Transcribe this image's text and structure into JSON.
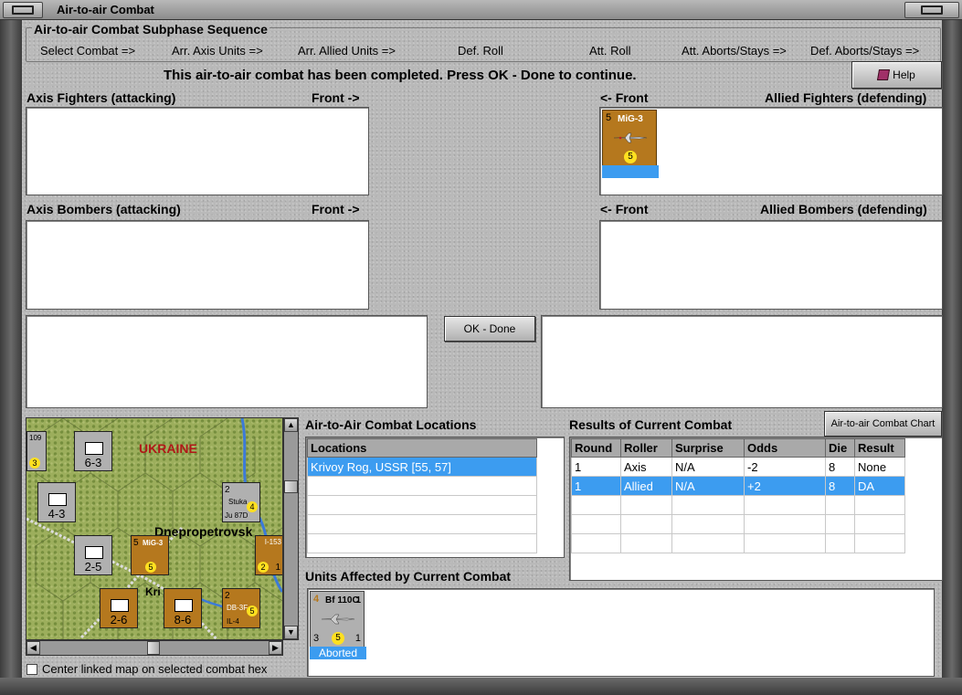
{
  "window": {
    "title": "Air-to-air Combat"
  },
  "subphase": {
    "label": "Air-to-air Combat Subphase Sequence",
    "steps": [
      "Select Combat =>",
      "Arr. Axis Units =>",
      "Arr. Allied Units =>",
      "Def. Roll",
      "Att. Roll",
      "Att. Aborts/Stays =>",
      "Def. Aborts/Stays =>"
    ]
  },
  "status_message": "This air-to-air combat has been completed.  Press OK - Done to continue.",
  "help_label": "Help",
  "sections": {
    "axis_fighters": "Axis Fighters (attacking)",
    "axis_fighters_front": "Front ->",
    "allied_fighters": "Allied Fighters (defending)",
    "allied_fighters_front": "<- Front",
    "axis_bombers": "Axis Bombers (attacking)",
    "axis_bombers_front": "Front ->",
    "allied_bombers": "Allied Bombers (defending)",
    "allied_bombers_front": "<- Front"
  },
  "allied_fighter_unit": {
    "name": "MiG-3",
    "left_value": "5",
    "bottom_value": "5",
    "color": "#b5781e"
  },
  "ok_done_label": "OK - Done",
  "locations": {
    "title": "Air-to-Air Combat Locations",
    "header": "Locations",
    "rows": [
      "Krivoy Rog, USSR [55, 57]",
      "",
      "",
      "",
      "",
      ""
    ]
  },
  "results": {
    "title": "Results of Current Combat",
    "chart_button": "Air-to-air Combat Chart",
    "headers": [
      "Round",
      "Roller",
      "Surprise",
      "Odds",
      "Die",
      "Result"
    ],
    "rows": [
      [
        "1",
        "Axis",
        "N/A",
        "-2",
        "8",
        "None"
      ],
      [
        "1",
        "Allied",
        "N/A",
        "+2",
        "8",
        "DA"
      ],
      [
        "",
        "",
        "",
        "",
        "",
        ""
      ],
      [
        "",
        "",
        "",
        "",
        "",
        ""
      ],
      [
        "",
        "",
        "",
        "",
        "",
        ""
      ],
      [
        "",
        "",
        "",
        "",
        "",
        ""
      ]
    ]
  },
  "affected": {
    "title": "Units Affected by Current Combat",
    "unit": {
      "name": "Bf 110C",
      "top_left": "4",
      "top_right": "1",
      "bottom_left": "3",
      "bottom_mid": "5",
      "bottom_right": "1",
      "status": "Aborted",
      "color": "#b0b0b0"
    }
  },
  "map": {
    "region_label": "UKRAINE",
    "city_label": "Dnepropetrovsk",
    "city_label2": "Kri",
    "units": [
      {
        "value": "6-3",
        "stack": "2"
      },
      {
        "value": "4-3",
        "stack": "3"
      },
      {
        "value": "2-5",
        "stack": "2"
      },
      {
        "value": "2-6",
        "stack": "2"
      },
      {
        "value": "8-6",
        "stack": "2"
      }
    ],
    "air_units": [
      {
        "name": "Stuka",
        "value": "4",
        "sub": "Ju 87D",
        "top": "2",
        "stack": "4"
      },
      {
        "name": "MiG-3",
        "value": "5",
        "top": "5"
      },
      {
        "name": "I-153",
        "value": "2",
        "top": "1"
      },
      {
        "name": "DB-3F",
        "value": "5",
        "sub": "IL-4",
        "top": "2"
      }
    ],
    "misc_labels": [
      "109",
      "3"
    ]
  },
  "center_map_label": "Center linked map on selected combat hex"
}
